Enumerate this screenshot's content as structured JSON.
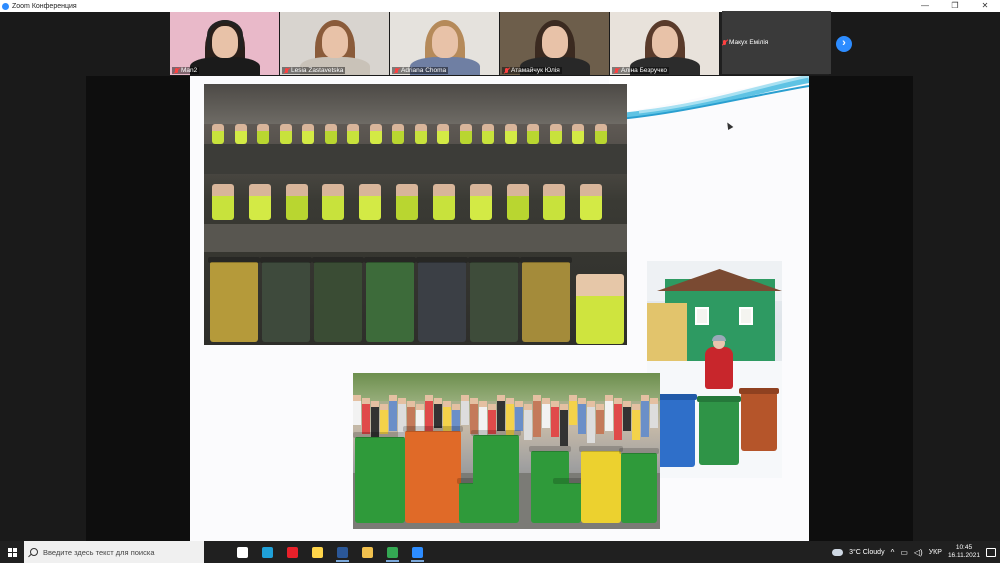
{
  "window": {
    "title": "Zoom Конференция",
    "controls": [
      "—",
      "❐",
      "✕"
    ]
  },
  "gallery": [
    {
      "name": "Man2",
      "bg": "#e9b9c9",
      "hair": "#2a1f1a",
      "body": "#1b1b1b",
      "headset": true
    },
    {
      "name": "Lesia Zastavetska",
      "bg": "#d8d4cf",
      "hair": "#8a5b3a",
      "body": "#c9c2b8",
      "headset": false
    },
    {
      "name": "Adriana Choma",
      "bg": "#e5e2dd",
      "hair": "#b58a5a",
      "body": "#6f7fa3",
      "headset": false,
      "active": true
    },
    {
      "name": "Атамайчук Юлія",
      "bg": "#6d5e4b",
      "hair": "#3b2a20",
      "body": "#282828",
      "headset": false
    },
    {
      "name": "Аліна Безручко",
      "bg": "#e8e2db",
      "hair": "#5a3b2b",
      "body": "#2c2c2c",
      "headset": false
    }
  ],
  "name_tile": {
    "big": "Макух Емілія",
    "label": "Макух Емілія"
  },
  "next_icon": "chevron-right-icon",
  "taskbar": {
    "search_placeholder": "Введите здесь текст для поиска",
    "apps": [
      {
        "name": "task-view-icon",
        "color": "#ffffff",
        "open": false
      },
      {
        "name": "edge-icon",
        "color": "#1fa0d8",
        "open": false
      },
      {
        "name": "opera-icon",
        "color": "#e8202a",
        "open": false
      },
      {
        "name": "store-icon",
        "color": "#ffd54a",
        "open": false
      },
      {
        "name": "word-icon",
        "color": "#2b5797",
        "open": true
      },
      {
        "name": "explorer-icon",
        "color": "#f2c14e",
        "open": false
      },
      {
        "name": "chrome-icon",
        "color": "#34a853",
        "open": true
      },
      {
        "name": "zoom-icon",
        "color": "#2d8cff",
        "open": true
      }
    ],
    "weather": "3°C  Cloudy",
    "lang": "УКР",
    "time": "10:45",
    "date": "16.11.2021"
  }
}
